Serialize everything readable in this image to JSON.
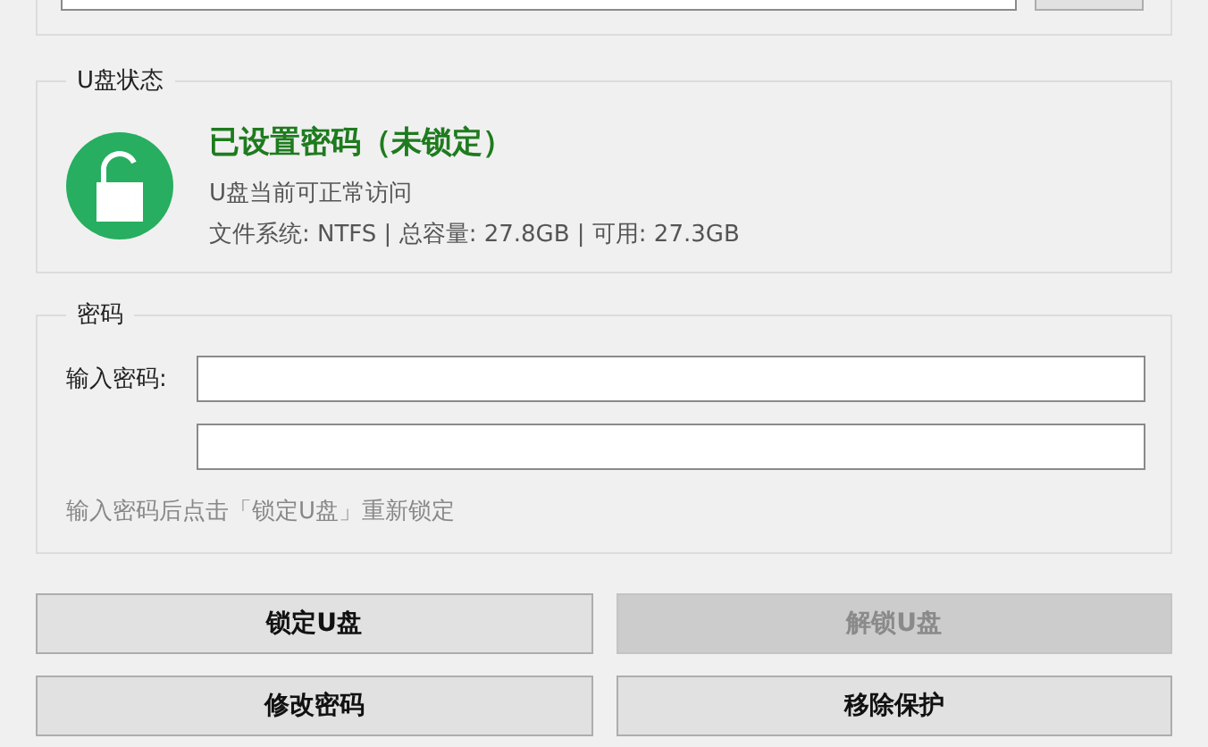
{
  "status": {
    "legend": "U盘状态",
    "locked": false,
    "title": "已设置密码（未锁定）",
    "description": "U盘当前可正常访问",
    "details": "文件系统: NTFS | 总容量: 27.8GB | 可用: 27.3GB"
  },
  "password": {
    "legend": "密码",
    "label": "输入密码:",
    "hint": "输入密码后点击「锁定U盘」重新锁定"
  },
  "buttons": [
    {
      "label": "锁定U盘",
      "disabled": false
    },
    {
      "label": "解锁U盘",
      "disabled": true
    },
    {
      "label": "修改密码",
      "disabled": false
    },
    {
      "label": "移除保护",
      "disabled": false
    }
  ]
}
